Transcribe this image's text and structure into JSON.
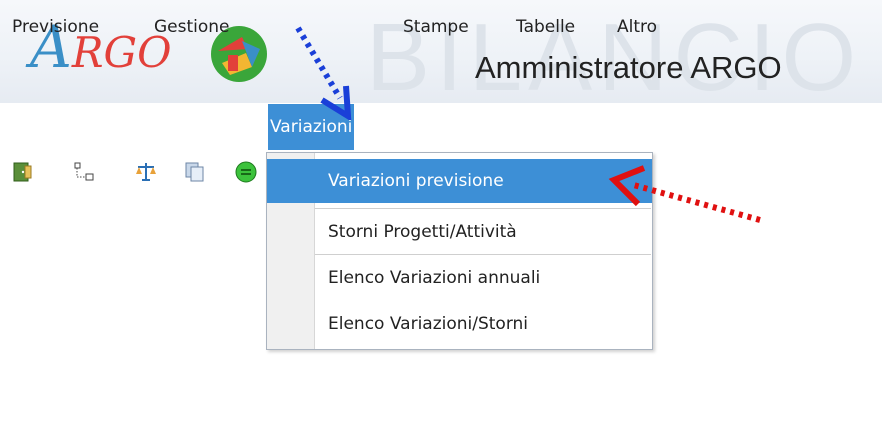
{
  "banner": {
    "logo_first": "A",
    "logo_rest": "RGO",
    "watermark": "BILANCIO",
    "admin_title": "Amministratore ARGO"
  },
  "menubar": {
    "items": [
      {
        "label": "Previsione"
      },
      {
        "label": "Gestione"
      },
      {
        "label": "Variazioni"
      },
      {
        "label": "Stampe"
      },
      {
        "label": "Tabelle"
      },
      {
        "label": "Altro"
      }
    ],
    "active_index": 2
  },
  "toolbar": {
    "icons": [
      "door-icon",
      "tree-icon",
      "scale-icon",
      "copy-icon",
      "green-circle-icon"
    ]
  },
  "dropdown": {
    "items": [
      {
        "label": "Variazioni previsione"
      },
      {
        "label": "Storni Progetti/Attività"
      },
      {
        "label": "Elenco Variazioni annuali"
      },
      {
        "label": "Elenco Variazioni/Storni"
      }
    ],
    "highlighted_index": 0
  },
  "colors": {
    "accent": "#3d8fd6",
    "arrow_blue": "#1a3fd8",
    "arrow_red": "#e01010"
  }
}
